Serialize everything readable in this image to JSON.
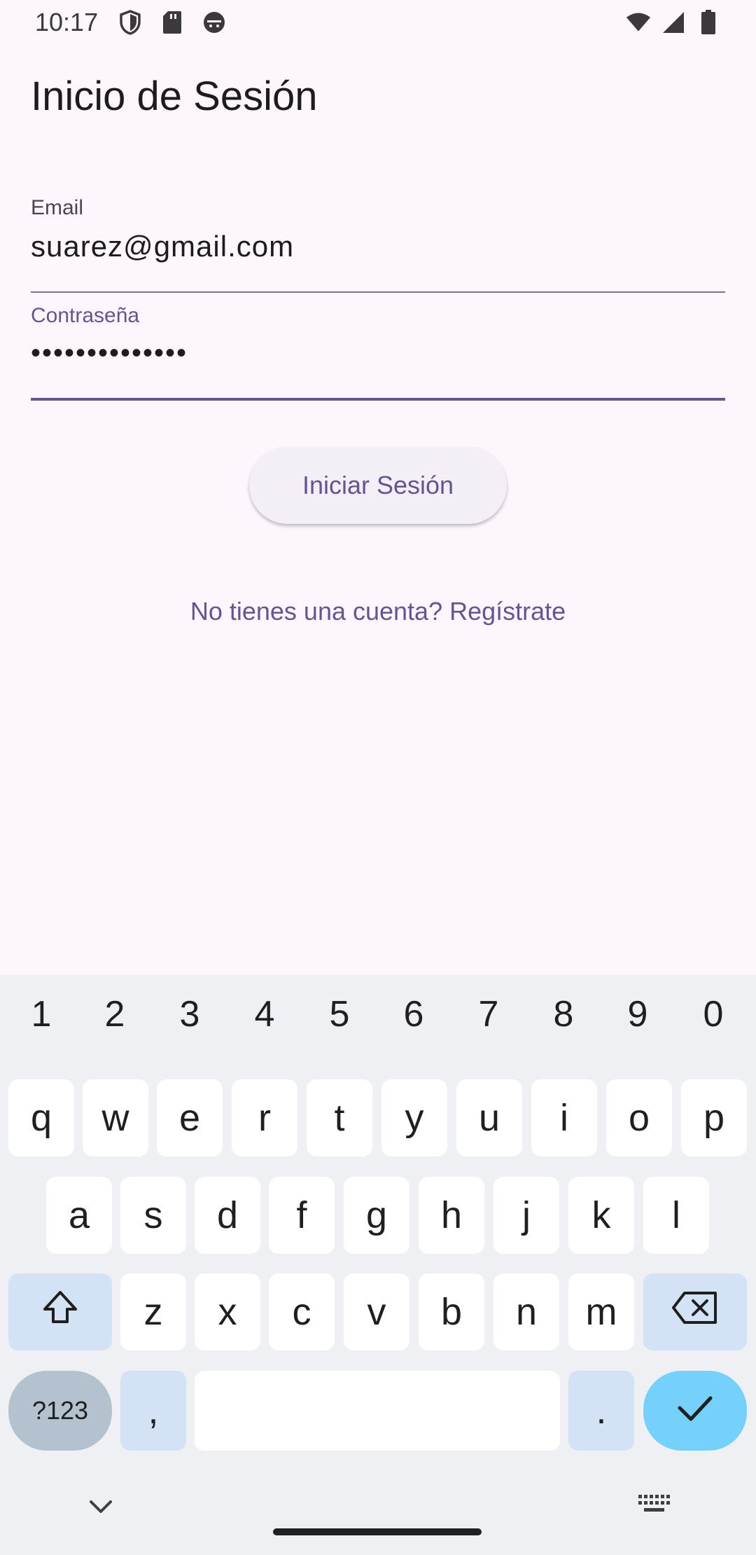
{
  "status_bar": {
    "time": "10:17",
    "left_icons": [
      "shield-icon",
      "sd-card-icon",
      "android-icon"
    ],
    "right_icons": [
      "wifi-icon",
      "signal-icon",
      "battery-icon"
    ]
  },
  "app_bar": {
    "title": "Inicio de Sesión"
  },
  "form": {
    "email": {
      "label": "Email",
      "value": "suarez@gmail.com"
    },
    "password": {
      "label": "Contraseña",
      "value": "••••••••••••••"
    },
    "login_button": "Iniciar Sesión",
    "register_link": "No tienes una cuenta? Regístrate"
  },
  "keyboard": {
    "numbers": [
      "1",
      "2",
      "3",
      "4",
      "5",
      "6",
      "7",
      "8",
      "9",
      "0"
    ],
    "row1": [
      "q",
      "w",
      "e",
      "r",
      "t",
      "y",
      "u",
      "i",
      "o",
      "p"
    ],
    "row2": [
      "a",
      "s",
      "d",
      "f",
      "g",
      "h",
      "j",
      "k",
      "l"
    ],
    "row3": [
      "z",
      "x",
      "c",
      "v",
      "b",
      "n",
      "m"
    ],
    "symbols_label": "?123",
    "comma": ",",
    "period": ".",
    "icons": [
      "shift-icon",
      "backspace-icon",
      "enter-check-icon",
      "hide-keyboard-icon",
      "keyboard-switch-icon"
    ]
  },
  "colors": {
    "background": "#fdf7fd",
    "accent": "#65558f",
    "keyboard_bg": "#eff0f4",
    "enter_key": "#75d1fb"
  }
}
